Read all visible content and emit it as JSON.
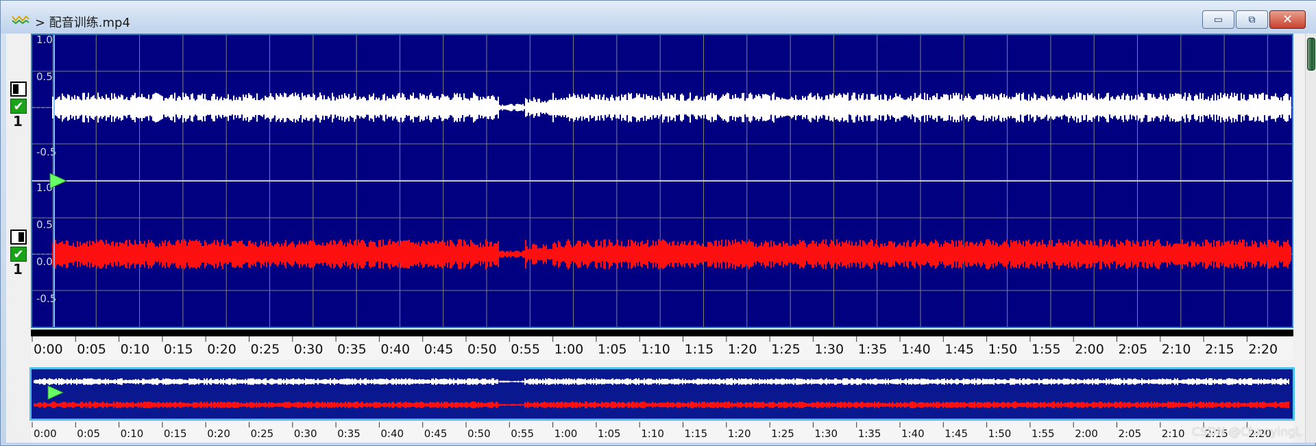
{
  "window": {
    "title": "> 配音训练.mp4",
    "buttons": {
      "minimize": "▭",
      "maximize": "⧉",
      "close": "✕"
    }
  },
  "channels": [
    {
      "number": "1",
      "enabled": true,
      "color": "#ffffff",
      "y_labels": [
        "1.0",
        "0.5",
        "-0.5"
      ]
    },
    {
      "number": "1",
      "enabled": true,
      "color": "#ff1010",
      "y_labels": [
        "1.0",
        "0.5",
        "0.0",
        "-0.5"
      ]
    }
  ],
  "timeline": {
    "ticks": [
      "0:00",
      "0:05",
      "0:10",
      "0:15",
      "0:20",
      "0:25",
      "0:30",
      "0:35",
      "0:40",
      "0:45",
      "0:50",
      "0:55",
      "1:00",
      "1:05",
      "1:10",
      "1:15",
      "1:20",
      "1:25",
      "1:30",
      "1:35",
      "1:40",
      "1:45",
      "1:50",
      "1:55",
      "2:00",
      "2:05",
      "2:10",
      "2:15",
      "2:20"
    ]
  },
  "overview_timeline": {
    "ticks": [
      "0:00",
      "0:05",
      "0:10",
      "0:15",
      "0:20",
      "0:25",
      "0:30",
      "0:35",
      "0:40",
      "0:45",
      "0:50",
      "0:55",
      "1:00",
      "1:05",
      "1:10",
      "1:15",
      "1:20",
      "1:25",
      "1:30",
      "1:35",
      "1:40",
      "1:45",
      "1:50",
      "1:55",
      "2:00",
      "2:05",
      "2:10",
      "2:15",
      "2:20"
    ]
  },
  "colors": {
    "background": "#000080",
    "grid": "#808080",
    "playhead": "#66ff66",
    "left_channel": "#ffffff",
    "right_channel": "#ff1010"
  },
  "watermark": "CSDN @ChaoyingL"
}
